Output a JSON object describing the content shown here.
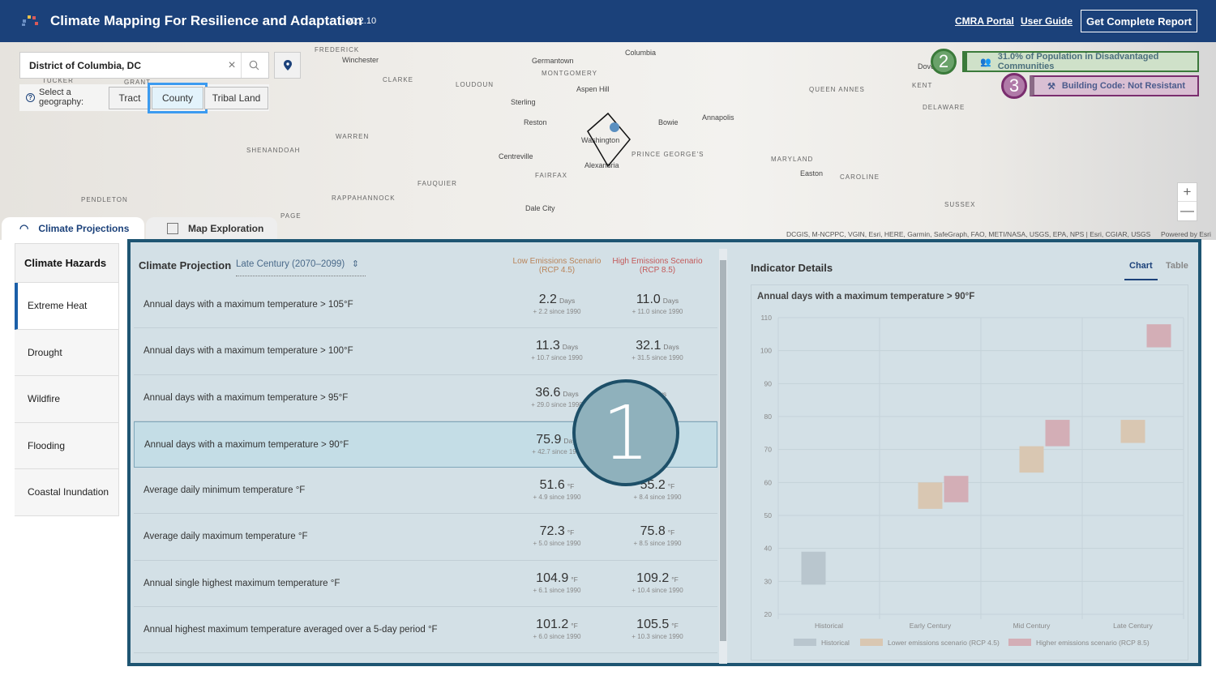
{
  "header": {
    "title": "Climate Mapping For Resilience and Adaptation",
    "version": "v0.2.10",
    "links": [
      "CMRA Portal",
      "User Guide"
    ],
    "report_button": "Get Complete Report",
    "brand_color": "#1b417a"
  },
  "search": {
    "value": "District of Columbia, DC",
    "placeholder": ""
  },
  "geography": {
    "label": "Select a geography:",
    "options": [
      "Tract",
      "County",
      "Tribal Land"
    ],
    "selected": "County"
  },
  "map": {
    "labels": [
      "FREDERICK",
      "Winchester",
      "CLARKE",
      "LOUDOUN",
      "Germantown",
      "MONTGOMERY",
      "Aspen Hill",
      "Columbia",
      "Sterling",
      "Reston",
      "Bowie",
      "Annapolis",
      "Washington",
      "PRINCE GEORGE'S",
      "Alexandria",
      "Centreville",
      "FAIRFAX",
      "WARREN",
      "SHENANDOAH",
      "FAUQUIER",
      "RAPPAHANNOCK",
      "PENDLETON",
      "PAGE",
      "Dale City",
      "MARYLAND",
      "Easton",
      "CAROLINE",
      "DELAWARE",
      "KENT",
      "QUEEN ANNES",
      "SUSSEX",
      "TUCKER",
      "GRANT",
      "Dover"
    ],
    "attribution": "DCGIS, M-NCPPC, VGIN, Esri, HERE, Garmin, SafeGraph, FAO, METI/NASA, USGS, EPA, NPS | Esri, CGIAR, USGS",
    "powered": "Powered by Esri",
    "zoom_in": "+",
    "zoom_out": "—"
  },
  "badges": [
    {
      "num": "2",
      "text": "31.0% of Population in Disadvantaged Communities",
      "icon": "people-icon",
      "color": "#3a7a3a"
    },
    {
      "num": "3",
      "text": "Building Code: Not Resistant",
      "icon": "tools-icon",
      "color": "#7a2d6e"
    }
  ],
  "tabs": [
    {
      "label": "Climate Projections",
      "active": true
    },
    {
      "label": "Map Exploration",
      "active": false
    }
  ],
  "sidebar": {
    "title": "Climate Hazards",
    "items": [
      "Extreme Heat",
      "Drought",
      "Wildfire",
      "Flooding",
      "Coastal Inundation"
    ],
    "active": "Extreme Heat"
  },
  "projection": {
    "title": "Climate Projection",
    "period": "Late Century (2070–2099)",
    "col_low": "Low Emissions Scenario (RCP 4.5)",
    "col_high": "High Emissions Scenario (RCP 8.5)",
    "rows": [
      {
        "name": "Annual days with a maximum temperature > 105°F",
        "low": "2.2",
        "low_unit": "Days",
        "low_delta": "+ 2.2 since 1990",
        "high": "11.0",
        "high_unit": "Days",
        "high_delta": "+ 11.0 since 1990"
      },
      {
        "name": "Annual days with a maximum temperature > 100°F",
        "low": "11.3",
        "low_unit": "Days",
        "low_delta": "+ 10.7 since 1990",
        "high": "32.1",
        "high_unit": "Days",
        "high_delta": "+ 31.5 since 1990"
      },
      {
        "name": "Annual days with a maximum temperature > 95°F",
        "low": "36.6",
        "low_unit": "Days",
        "low_delta": "+ 29.0 since 1990",
        "high": "",
        "high_unit": "Days",
        "high_delta": ""
      },
      {
        "name": "Annual days with a maximum temperature > 90°F",
        "low": "75.9",
        "low_unit": "Days",
        "low_delta": "+ 42.7 since 1990",
        "high": "",
        "high_unit": "Days",
        "high_delta": "",
        "selected": true
      },
      {
        "name": "Average daily minimum temperature °F",
        "low": "51.6",
        "low_unit": "°F",
        "low_delta": "+ 4.9 since 1990",
        "high": "55.2",
        "high_unit": "°F",
        "high_delta": "+ 8.4 since 1990"
      },
      {
        "name": "Average daily maximum temperature °F",
        "low": "72.3",
        "low_unit": "°F",
        "low_delta": "+ 5.0 since 1990",
        "high": "75.8",
        "high_unit": "°F",
        "high_delta": "+ 8.5 since 1990"
      },
      {
        "name": "Annual single highest maximum temperature °F",
        "low": "104.9",
        "low_unit": "°F",
        "low_delta": "+ 6.1 since 1990",
        "high": "109.2",
        "high_unit": "°F",
        "high_delta": "+ 10.4 since 1990"
      },
      {
        "name": "Annual highest maximum temperature averaged over a 5-day period °F",
        "low": "101.2",
        "low_unit": "°F",
        "low_delta": "+ 6.0 since 1990",
        "high": "105.5",
        "high_unit": "°F",
        "high_delta": "+ 10.3 since 1990"
      }
    ]
  },
  "annotation": {
    "num": "1"
  },
  "indicator": {
    "title": "Indicator Details",
    "tabs": [
      "Chart",
      "Table"
    ],
    "active_tab": "Chart"
  },
  "chart_data": {
    "type": "bar",
    "title": "Annual days with a maximum temperature > 90°F",
    "categories": [
      "Historical",
      "Early Century",
      "Mid Century",
      "Late Century"
    ],
    "yticks": [
      20,
      30,
      40,
      50,
      60,
      70,
      80,
      90,
      100,
      110
    ],
    "ylim": [
      20,
      110
    ],
    "grid": true,
    "legend_position": "bottom",
    "series": [
      {
        "name": "Historical",
        "color": "#b9c6ce",
        "ranges": [
          [
            29,
            39
          ],
          null,
          null,
          null
        ]
      },
      {
        "name": "Lower emissions scenario (RCP 4.5)",
        "color": "#d9c7b2",
        "ranges": [
          null,
          [
            52,
            60
          ],
          [
            63,
            71
          ],
          [
            72,
            79
          ]
        ]
      },
      {
        "name": "Higher emissions scenario (RCP 8.5)",
        "color": "#d3aeb6",
        "ranges": [
          null,
          [
            54,
            62
          ],
          [
            71,
            79
          ],
          [
            101,
            108
          ]
        ]
      }
    ]
  }
}
